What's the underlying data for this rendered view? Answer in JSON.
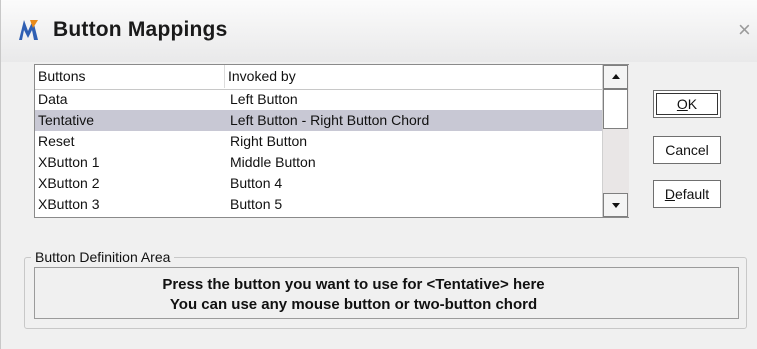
{
  "window": {
    "title": "Button Mappings",
    "close_glyph": "×",
    "icon": "microstation-m-icon",
    "icon_color": "#2f5fb3"
  },
  "list": {
    "columns": [
      "Buttons",
      "Invoked by"
    ],
    "rows": [
      {
        "button": "Data",
        "invoked_by": "Left Button",
        "selected": false
      },
      {
        "button": "Tentative",
        "invoked_by": "Left Button - Right Button Chord",
        "selected": true
      },
      {
        "button": "Reset",
        "invoked_by": "Right Button",
        "selected": false
      },
      {
        "button": "XButton 1",
        "invoked_by": "Middle Button",
        "selected": false
      },
      {
        "button": "XButton 2",
        "invoked_by": "Button 4",
        "selected": false
      },
      {
        "button": "XButton 3",
        "invoked_by": "Button 5",
        "selected": false
      }
    ],
    "selection_color": "#c8c8d4"
  },
  "buttons": {
    "ok": {
      "label": "OK",
      "mnemonic": "O"
    },
    "cancel": {
      "label": "Cancel"
    },
    "default": {
      "label": "Default",
      "mnemonic": "D"
    }
  },
  "definition_area": {
    "label": "Button Definition Area",
    "line1": "Press the button you want to use for <Tentative> here",
    "line2": "You can use any mouse button or two-button chord"
  }
}
